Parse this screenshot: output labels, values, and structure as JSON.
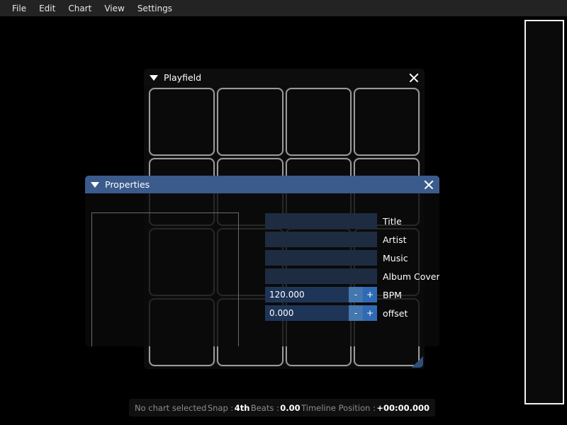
{
  "menubar": {
    "items": [
      {
        "label": "File"
      },
      {
        "label": "Edit"
      },
      {
        "label": "Chart"
      },
      {
        "label": "View"
      },
      {
        "label": "Settings"
      }
    ]
  },
  "colors": {
    "app_background": "#000000",
    "menubar_background": "#232323",
    "active_titlebar": "#3a5b8c",
    "inactive_titlebar": "#0d0d0d",
    "pad_border": "#9a9a9a",
    "text_input_fill": "#1e2c42",
    "num_input_fill": "#1e3558",
    "step_button_fill": "#3d6ea5",
    "timeline_border": "#f2f2f2",
    "status_label": "#8c8c8c",
    "status_value": "#ffffff"
  },
  "playfield_window": {
    "title": "Playfield",
    "collapse_icon": "triangle-down-icon",
    "close_icon": "close-icon",
    "pad_count": 16,
    "columns": 4,
    "rows": 4
  },
  "properties_window": {
    "title": "Properties",
    "collapse_icon": "triangle-down-icon",
    "close_icon": "close-icon",
    "cover_preview_placeholder": "",
    "fields": [
      {
        "label": "Title",
        "type": "text",
        "value": "",
        "placeholder": ""
      },
      {
        "label": "Artist",
        "type": "text",
        "value": "",
        "placeholder": ""
      },
      {
        "label": "Music",
        "type": "text",
        "value": "",
        "placeholder": ""
      },
      {
        "label": "Album Cover",
        "type": "text",
        "value": "",
        "placeholder": ""
      },
      {
        "label": "BPM",
        "type": "number",
        "value": "120.000",
        "minus": "-",
        "plus": "+"
      },
      {
        "label": "offset",
        "type": "number",
        "value": "0.000",
        "minus": "-",
        "plus": "+"
      }
    ]
  },
  "timeline": {
    "label": "timeline-strip"
  },
  "statusbar": {
    "chart_status": "No chart selected",
    "snap_label": "Snap :",
    "snap_value": "4th",
    "beats_label": "Beats :",
    "beats_value": "0.00",
    "timeline_label": "Timeline Position :",
    "timeline_value": "+00:00.000"
  }
}
